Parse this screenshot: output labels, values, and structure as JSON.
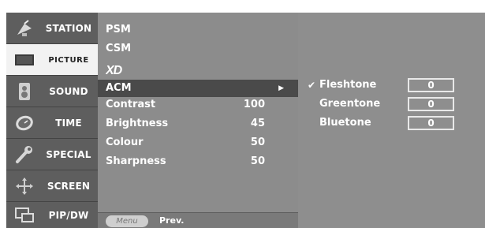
{
  "sidebar": {
    "items": [
      {
        "label": "STATION",
        "icon": "satellite-dish-icon"
      },
      {
        "label": "PICTURE",
        "icon": "tv-screen-icon",
        "selected": true
      },
      {
        "label": "SOUND",
        "icon": "speaker-icon"
      },
      {
        "label": "TIME",
        "icon": "clock-icon"
      },
      {
        "label": "SPECIAL",
        "icon": "wrench-icon"
      },
      {
        "label": "SCREEN",
        "icon": "screen-adjust-icon"
      },
      {
        "label": "PIP/DW",
        "icon": "picture-in-picture-icon"
      }
    ]
  },
  "picture_menu": {
    "psm": "PSM",
    "csm": "CSM",
    "xd_logo": "XD",
    "acm": "ACM",
    "acm_arrow": "▶",
    "settings": [
      {
        "label": "Contrast",
        "value": "100"
      },
      {
        "label": "Brightness",
        "value": "45"
      },
      {
        "label": "Colour",
        "value": "50"
      },
      {
        "label": "Sharpness",
        "value": "50"
      }
    ],
    "footer": {
      "menu_button": "Menu",
      "prev_label": "Prev."
    }
  },
  "acm_panel": {
    "check_mark": "✔",
    "tones": [
      {
        "label": "Fleshtone",
        "value": "0",
        "checked": true
      },
      {
        "label": "Greentone",
        "value": "0",
        "checked": false
      },
      {
        "label": "Bluetone",
        "value": "0",
        "checked": false
      }
    ]
  },
  "colors": {
    "sidebar_bg": "#5e5e5e",
    "sidebar_selected_bg": "#f2f2f2",
    "middle_bg": "#8c8c8c",
    "highlight_bg": "#4a4a4a",
    "right_bg": "#8e8e8e",
    "text": "#ffffff"
  }
}
